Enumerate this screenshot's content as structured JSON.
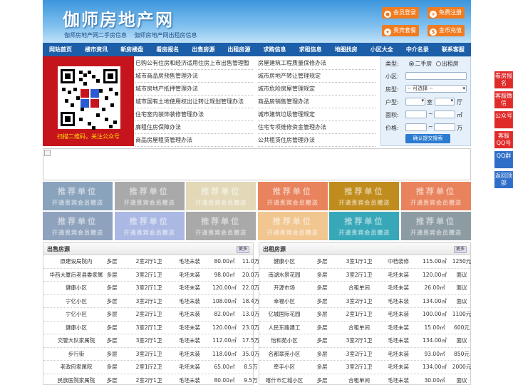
{
  "header": {
    "title": "伽师房地产网",
    "sub_links": [
      "伽师房地产网二手房信息",
      "伽师房地产网出租房信息"
    ],
    "buttons": [
      {
        "label": "会员登录",
        "icon": "user-icon"
      },
      {
        "label": "免费注册",
        "icon": "register-icon"
      },
      {
        "label": "贵宾套餐",
        "icon": "vip-icon"
      },
      {
        "label": "金币充值",
        "icon": "coin-icon"
      }
    ]
  },
  "nav": [
    "网站首页",
    "楼市资讯",
    "新房楼盘",
    "看房报名",
    "出售房源",
    "出租房源",
    "求购信息",
    "求租信息",
    "地图找房",
    "小区大全",
    "中介名录",
    "联系客服"
  ],
  "qr": {
    "caption": "扫描二维码，关注公众号"
  },
  "news_left": [
    "已购公有住房和经济适用住房上市出售管理暂",
    "城市商品房预售管理办法",
    "城市房地产抵押管理办法",
    "城市国有土地使用权出让转让规划管理办法",
    "住宅室内装饰装修管理办法",
    "廉租住房保障办法",
    "商品房屋租赁管理办法"
  ],
  "news_right": [
    "房屋建筑工程质量保修办法",
    "城市房地产转让管理规定",
    "城市危险房屋管理规定",
    "商品房销售管理办法",
    "城市建筑垃圾管理规定",
    "住宅专项维修资金管理办法",
    "公共租赁住房管理办法"
  ],
  "search": {
    "type_label": "类型:",
    "type_options": [
      "二手房",
      "出租房"
    ],
    "community_label": "小区:",
    "house_label": "房型:",
    "house_select": "-- 可选择 --",
    "layout_label": "户型:",
    "room": "室",
    "hall": "厅",
    "area_label": "面积:",
    "area_unit": "㎡",
    "price_label": "价格:",
    "price_unit": "万",
    "submit": "确认提交搜索"
  },
  "tiles": {
    "line1": "推荐单位",
    "line2": "开通贵宾会员赠送",
    "colors": [
      "#8aa3bc",
      "#a9a9a9",
      "#e3d9b8",
      "#e9835d",
      "#c08c1d",
      "#e9835d",
      "#8fa2bd",
      "#aab8e3",
      "#a9a9a9",
      "#f1c690",
      "#38a8b9",
      "#8d9ca3"
    ]
  },
  "sale": {
    "title": "出售房源",
    "more": "更多",
    "rows": [
      [
        "原建设局院内",
        "多层",
        "2室2厅1卫",
        "毛坯未装",
        "80.00㎡",
        "11.0万"
      ],
      [
        "华西大厦后老县委家属",
        "多层",
        "3室2厅1卫",
        "毛坯未装",
        "98.00㎡",
        "20.0万"
      ],
      [
        "健康小区",
        "多层",
        "3室2厅1卫",
        "毛坯未装",
        "120.00㎡",
        "22.0万"
      ],
      [
        "宁亿小区",
        "多层",
        "3室2厅1卫",
        "毛坯未装",
        "108.00㎡",
        "18.4万"
      ],
      [
        "宁亿小区",
        "多层",
        "2室2厅1卫",
        "毛坯未装",
        "82.00㎡",
        "13.0万"
      ],
      [
        "健康小区",
        "多层",
        "3室2厅1卫",
        "毛坯未装",
        "120.00㎡",
        "23.0万"
      ],
      [
        "交警大队家属院",
        "多层",
        "3室2厅1卫",
        "毛坯未装",
        "112.00㎡",
        "17.5万"
      ],
      [
        "步行街",
        "多层",
        "3室2厅1卫",
        "毛坯未装",
        "118.00㎡",
        "35.0万"
      ],
      [
        "老政府家属院",
        "多层",
        "2室1厅2卫",
        "毛坯未装",
        "65.00㎡",
        "8.5万"
      ],
      [
        "民族医院家属院",
        "多层",
        "2室2厅1卫",
        "毛坯未装",
        "80.00㎡",
        "9.5万"
      ]
    ]
  },
  "rent": {
    "title": "出租房源",
    "more": "更多",
    "rows": [
      [
        "健康小区",
        "多层",
        "3室1厅1卫",
        "中档装修",
        "115.00㎡",
        "1250元"
      ],
      [
        "南湖水景花园",
        "多层",
        "3室2厅1卫",
        "毛坯未装",
        "120.00㎡",
        "面议"
      ],
      [
        "开源市场",
        "多层",
        "合租单间",
        "毛坯未装",
        "26.00㎡",
        "面议"
      ],
      [
        "幸福小区",
        "多层",
        "3室2厅1卫",
        "毛坯未装",
        "134.00㎡",
        "面议"
      ],
      [
        "亿城国际花园",
        "多层",
        "2室1厅1卫",
        "毛坯未装",
        "100.00㎡",
        "1100元"
      ],
      [
        "人民东路建工",
        "多层",
        "合租单间",
        "毛坯未装",
        "15.00㎡",
        "600元"
      ],
      [
        "怡和苑小区",
        "多层",
        "3室2厅1卫",
        "毛坯未装",
        "134.00㎡",
        "面议"
      ],
      [
        "名都翠苑小区",
        "多层",
        "3室2厅1卫",
        "毛坯未装",
        "93.00㎡",
        "850元"
      ],
      [
        "牵手小区",
        "多层",
        "3室2厅1卫",
        "毛坯未装",
        "134.00㎡",
        "2000元"
      ],
      [
        "喀什市汇城小区",
        "多层",
        "合租单间",
        "毛坯未装",
        "30.00㎡",
        "面议"
      ]
    ]
  },
  "side": [
    "看房报名",
    "客服微信",
    "公众号",
    "客服QQ号",
    "QQ群",
    "返回顶部"
  ]
}
